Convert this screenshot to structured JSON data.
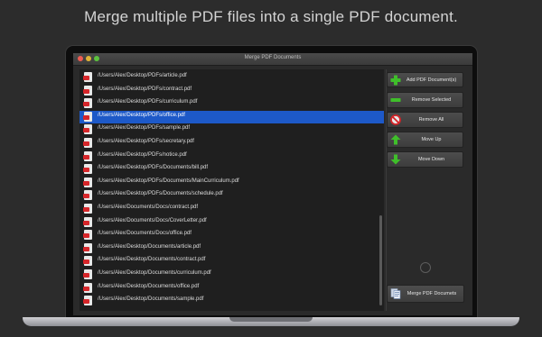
{
  "headline": "Merge multiple PDF files into a single PDF document.",
  "window": {
    "title": "Merge PDF Documents"
  },
  "files": [
    "/Users/Alex/Desktop/PDFs/article.pdf",
    "/Users/Alex/Desktop/PDFs/contract.pdf",
    "/Users/Alex/Desktop/PDFs/curriculum.pdf",
    "/Users/Alex/Desktop/PDFs/office.pdf",
    "/Users/Alex/Desktop/PDFs/sample.pdf",
    "/Users/Alex/Desktop/PDFs/secretary.pdf",
    "/Users/Alex/Desktop/PDFs/notice.pdf",
    "/Users/Alex/Desktop/PDFs/Documents/bill.pdf",
    "/Users/Alex/Desktop/PDFs/Documents/MainCurriculum.pdf",
    "/Users/Alex/Desktop/PDFs/Documents/schedule.pdf",
    "/Users/Alex/Documents/Docs/contract.pdf",
    "/Users/Alex/Documents/Docs/CoverLetter.pdf",
    "/Users/Alex/Documents/Docs/office.pdf",
    "/Users/Alex/Desktop/Documents/article.pdf",
    "/Users/Alex/Desktop/Documents/contract.pdf",
    "/Users/Alex/Desktop/Documents/curriculum.pdf",
    "/Users/Alex/Desktop/Documents/office.pdf",
    "/Users/Alex/Desktop/Documents/sample.pdf"
  ],
  "selected_file": "/Users/Alex/Desktop/PDFs/office.pdf",
  "buttons": {
    "add": "Add PDF Document(s)",
    "remove_selected": "Remove Selected",
    "remove_all": "Remove All",
    "move_up": "Move Up",
    "move_down": "Move Down",
    "merge": "Merge PDF Documets"
  },
  "icons": {
    "add": "plus-icon",
    "remove_selected": "minus-icon",
    "remove_all": "prohibited-icon",
    "move_up": "arrow-up-icon",
    "move_down": "arrow-down-icon",
    "merge": "merge-documents-icon",
    "file": "pdf-file-icon"
  },
  "colors": {
    "selection": "#1d59c8",
    "accent_green": "#3fbf2a",
    "accent_red": "#d6262a"
  }
}
